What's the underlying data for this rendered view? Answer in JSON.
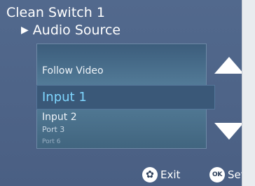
{
  "header": {
    "title": "Clean Switch 1",
    "subtitle": "Audio Source",
    "subtitle_icon": "triangle-right-icon"
  },
  "menu": {
    "items_above": [
      "Follow Video"
    ],
    "selected": "Input 1",
    "items_below": [
      "Input 2",
      "Port 3",
      "Port 6"
    ]
  },
  "navigation": {
    "up_icon": "triangle-up-icon",
    "down_icon": "triangle-down-icon"
  },
  "footer": {
    "exit_label": "Exit",
    "exit_icon": "gear-icon",
    "set_label": "Set",
    "set_icon_text": "OK"
  },
  "colors": {
    "background": "#4f6689",
    "selected_text": "#7fd6ff",
    "list_gradient_mid": "#567f9b",
    "text": "#ffffff"
  }
}
